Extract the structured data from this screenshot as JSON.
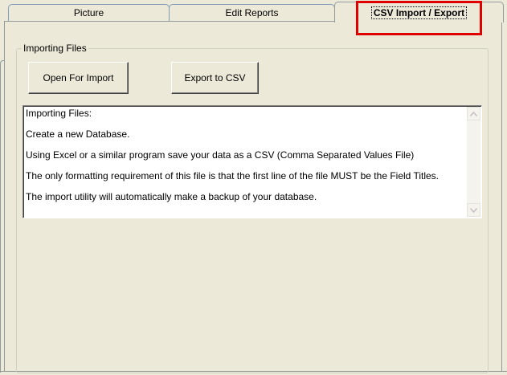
{
  "tabs": [
    {
      "label": "Picture"
    },
    {
      "label": "Edit Reports"
    },
    {
      "label": "CSV Import / Export",
      "selected": true
    }
  ],
  "importing": {
    "group_title": "Importing Files",
    "open_button": "Open For Import",
    "export_button": "Export to CSV",
    "info_lines": [
      "Importing Files:",
      "Create a new Database.",
      "Using Excel or a similar program save your data as a CSV (Comma Separated Values File)",
      "The only formatting requirement of this file is that the first line of the file MUST be the Field Titles.",
      "The import utility will automatically make a backup of your database."
    ]
  },
  "colors": {
    "face": "#ece9d8",
    "highlight_box": "#e00000"
  },
  "icons": {
    "scroll_up": "scroll-up-arrow-icon",
    "scroll_down": "scroll-down-arrow-icon"
  }
}
